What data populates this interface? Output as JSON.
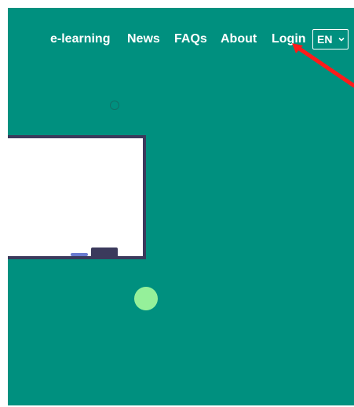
{
  "nav": {
    "links": [
      {
        "label": "e-learning"
      },
      {
        "label": "News"
      },
      {
        "label": "FAQs"
      },
      {
        "label": "About"
      },
      {
        "label": "Login"
      }
    ],
    "language": {
      "selected": "EN",
      "icon": "chevron-down-icon"
    }
  },
  "colors": {
    "background": "#00907f",
    "nav_text": "#ffffff",
    "board_frame": "#3b3a5c",
    "accent_dot": "#95f09a",
    "annotation_arrow": "#ff0000"
  }
}
